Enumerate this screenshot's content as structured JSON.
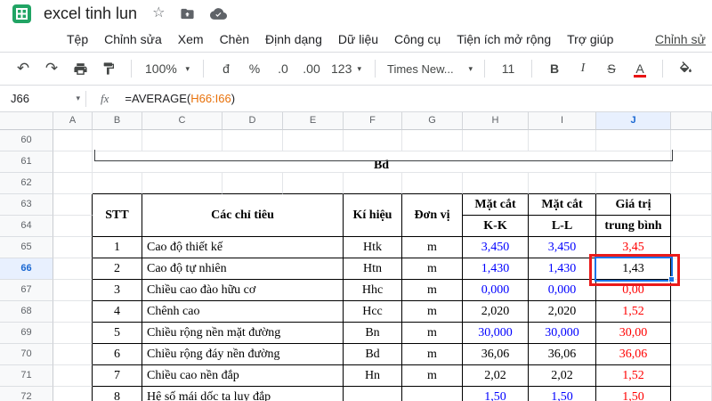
{
  "titlebar": {
    "title": "excel tinh lun"
  },
  "menubar": {
    "items": [
      "Tệp",
      "Chỉnh sửa",
      "Xem",
      "Chèn",
      "Định dạng",
      "Dữ liệu",
      "Công cụ",
      "Tiện ích mở rộng",
      "Trợ giúp"
    ],
    "last_edit": "Chỉnh sử"
  },
  "toolbar": {
    "undo": "↶",
    "redo": "↷",
    "zoom": "100%",
    "currency": "đ",
    "percent": "%",
    "decrease_decimal": ".0",
    "increase_decimal": ".00",
    "more_formats": "123",
    "font": "Times New...",
    "font_size": "11",
    "bold": "B",
    "italic": "I",
    "strikethrough": "S",
    "text_color": "A"
  },
  "formula_bar": {
    "cell_ref": "J66",
    "fx": "fx",
    "formula_pre": "=AVERAGE(",
    "formula_range": "H66:I66",
    "formula_post": ")"
  },
  "grid": {
    "col_headers": [
      "A",
      "B",
      "C",
      "D",
      "E",
      "F",
      "G",
      "H",
      "I",
      "J"
    ],
    "row_headers": [
      "60",
      "61",
      "62",
      "63",
      "64",
      "65",
      "66",
      "67",
      "68",
      "69",
      "70",
      "71",
      "72"
    ],
    "selected_cell": "J66"
  },
  "sheet": {
    "chart_label": "Bd",
    "table": {
      "h_stt": "STT",
      "h_criteria": "Các chỉ tiêu",
      "h_symbol": "Kí hiệu",
      "h_unit": "Đơn vị",
      "h_sec": "Mặt cắt",
      "h_kk": "K-K",
      "h_ll": "L-L",
      "h_val": "Giá trị",
      "h_avg": "trung bình",
      "rows": [
        {
          "stt": "1",
          "name": "Cao độ thiết kế",
          "sym": "Htk",
          "unit": "m",
          "kk": "3,450",
          "ll": "3,450",
          "avg": "3,45",
          "kc": "c-blue",
          "lc": "c-blue",
          "ac": "c-red"
        },
        {
          "stt": "2",
          "name": "Cao độ tự nhiên",
          "sym": "Htn",
          "unit": "m",
          "kk": "1,430",
          "ll": "1,430",
          "avg": "1,43",
          "kc": "c-blue",
          "lc": "c-blue",
          "ac": "c-black"
        },
        {
          "stt": "3",
          "name": "Chiều cao đào hữu cơ",
          "sym": "Hhc",
          "unit": "m",
          "kk": "0,000",
          "ll": "0,000",
          "avg": "0,00",
          "kc": "c-blue",
          "lc": "c-blue",
          "ac": "c-red"
        },
        {
          "stt": "4",
          "name": "Chênh cao",
          "sym": "Hcc",
          "unit": "m",
          "kk": "2,020",
          "ll": "2,020",
          "avg": "1,52",
          "kc": "c-black",
          "lc": "c-black",
          "ac": "c-red"
        },
        {
          "stt": "5",
          "name": "Chiều rộng nền mặt đường",
          "sym": "Bn",
          "unit": "m",
          "kk": "30,000",
          "ll": "30,000",
          "avg": "30,00",
          "kc": "c-blue",
          "lc": "c-blue",
          "ac": "c-red"
        },
        {
          "stt": "6",
          "name": "Chiều rộng đáy nền đường",
          "sym": "Bd",
          "unit": "m",
          "kk": "36,06",
          "ll": "36,06",
          "avg": "36,06",
          "kc": "c-black",
          "lc": "c-black",
          "ac": "c-red"
        },
        {
          "stt": "7",
          "name": "Chiều cao nền đắp",
          "sym": "Hn",
          "unit": "m",
          "kk": "2,02",
          "ll": "2,02",
          "avg": "1,52",
          "kc": "c-black",
          "lc": "c-black",
          "ac": "c-red"
        },
        {
          "stt": "8",
          "name": "Hệ số mái dốc ta luy đắp",
          "sym": "",
          "unit": "",
          "kk": "1,50",
          "ll": "1,50",
          "avg": "1,50",
          "kc": "c-blue",
          "lc": "c-blue",
          "ac": "c-red"
        }
      ]
    }
  },
  "colors": {
    "selection_blue": "#1a73e8",
    "annotation_red": "#ea1b1b",
    "value_blue": "#0000ff",
    "value_red": "#ff0000",
    "logo_green": "#21a464"
  }
}
